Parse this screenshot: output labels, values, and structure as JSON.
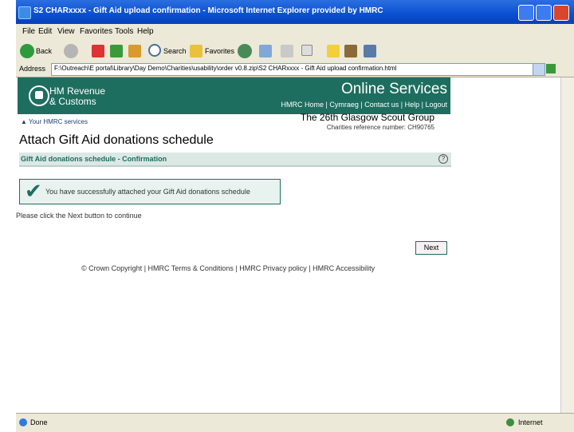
{
  "window": {
    "title": "S2 CHARxxxx - Gift Aid upload confirmation - Microsoft Internet Explorer provided by HMRC"
  },
  "menu": [
    "File",
    "Edit",
    "View",
    "Favorites",
    "Tools",
    "Help"
  ],
  "toolbar": {
    "back": "Back",
    "search": "Search",
    "favorites": "Favorites"
  },
  "address": {
    "label": "Address",
    "url": "F:\\Outreach\\E portal\\Library\\Day Demo\\Charities\\usability\\order v0.8.zip\\S2 CHARxxxx - Gift Aid upload confirmation.html"
  },
  "header": {
    "brand_line1": "HM Revenue",
    "brand_line2": "& Customs",
    "online_services": "Online Services",
    "nav": [
      "HMRC Home",
      "Cymraeg",
      "Contact us",
      "Help",
      "Logout"
    ]
  },
  "your_services": "Your HMRC services",
  "org_name": "The 26th Glasgow Scout Group",
  "charity_ref": "Charities reference number: CH90765",
  "page_title": "Attach Gift Aid donations schedule",
  "section_title": "Gift Aid donations schedule - Confirmation",
  "confirmation_message": "You have successfully attached your Gift Aid donations schedule",
  "instruction": "Please click the Next button to continue",
  "next_label": "Next",
  "footer": {
    "copyright": "© Crown Copyright",
    "links": [
      "HMRC Terms & Conditions",
      "HMRC Privacy policy",
      "HMRC Accessibility"
    ]
  },
  "status": {
    "done": "Done",
    "zone": "Internet"
  },
  "colors": {
    "hmrc_green": "#1e6e60",
    "titlebar_blue": "#0a4fd0"
  }
}
